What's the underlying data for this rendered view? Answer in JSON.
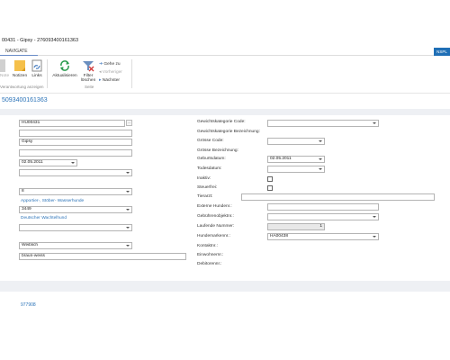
{
  "window": {
    "title": "00431 - Gipsy - 276093400161363"
  },
  "nav": {
    "tab_label": "NAVIGATE",
    "brand_tag": "NSPL"
  },
  "ribbon": {
    "btn_note": "Note",
    "btn_notizen": "Notizen",
    "btn_links": "Links",
    "group_left_label": "Verantwortung anzeigen",
    "btn_refresh": "Aktualisieren",
    "btn_filter_line1": "Filter",
    "btn_filter_line2": "löschen",
    "nav_goto": "Gehe zu",
    "nav_prev": "Vorheriger",
    "nav_next": "Nächster",
    "group_page_label": "Seite"
  },
  "record": {
    "title": "5093400161363"
  },
  "left": {
    "no_value": "HU00431",
    "name": "Gipsy",
    "date": "02.05.2011",
    "number": "8",
    "breed_link": "Apportier-, Stöber- Wasserhunde",
    "breed_code": "3449",
    "breed2_link": "Deutscher Wachtelhund",
    "sex": "Weiblich",
    "color": "braun-weiss"
  },
  "right": {
    "lbl_weight_cat": "Gewichtskategorie Code:",
    "lbl_weight_desc": "Gewichtskategorie Bezeichnung:",
    "lbl_size_code": "Grösse Code:",
    "lbl_size_desc": "Grösse Bezeichnung:",
    "lbl_birth": "Geburtsdatum:",
    "birth_value": "02.05.2011",
    "lbl_death": "Todesdatum:",
    "lbl_inactive": "Inaktiv:",
    "lbl_taxfree": "Steuerfrei:",
    "lbl_vet": "Tierarzt:",
    "lbl_ext": "Externe Hundenr.:",
    "lbl_fee": "Gebührenobjektnr.:",
    "lbl_serial": "Laufende Nummer:",
    "serial_value": "1",
    "lbl_tag": "Hundemarkennr.:",
    "tag_value": "HA00438",
    "lbl_contact": "Kontaktnr.:",
    "lbl_resident": "Einwohnernr.:",
    "lbl_debtor": "Debitorennr.:"
  },
  "footer": {
    "value": "977908"
  },
  "colors": {
    "accent": "#2b73b8",
    "section_bg": "#eef0f4"
  }
}
